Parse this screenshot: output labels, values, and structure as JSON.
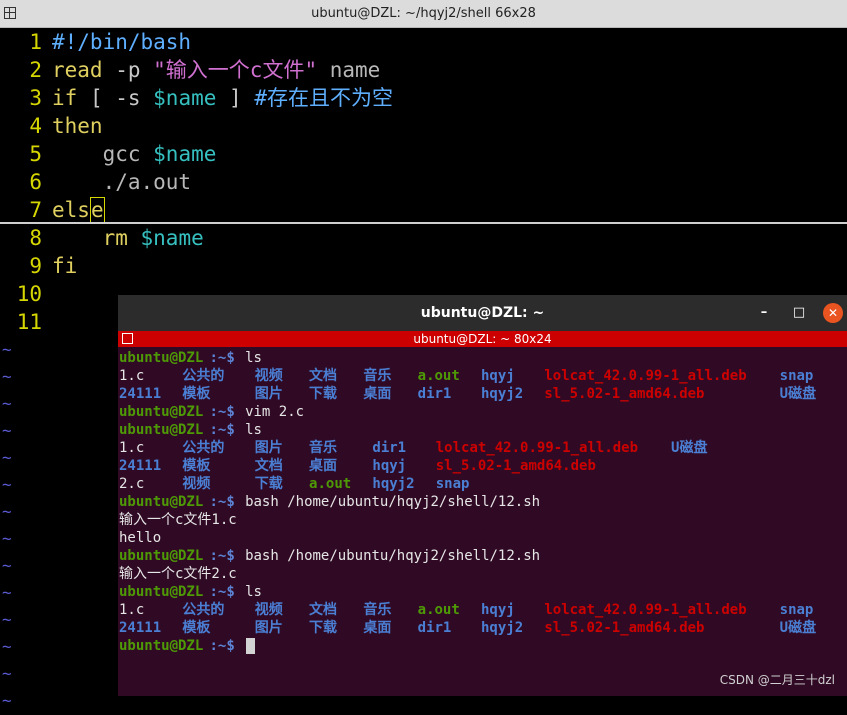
{
  "vim_window": {
    "title": "ubuntu@DZL: ~/hqyj2/shell 66x28",
    "lines": [
      {
        "num": "1",
        "segments": [
          {
            "t": "#!/bin/bash",
            "c": "kw-b"
          }
        ]
      },
      {
        "num": "2",
        "segments": [
          {
            "t": "read",
            "c": "kw-y"
          },
          {
            "t": " -p ",
            "c": "kw-w"
          },
          {
            "t": "\"输入一个c文件\"",
            "c": "kw-p"
          },
          {
            "t": " name",
            "c": "kw-g"
          }
        ]
      },
      {
        "num": "3",
        "segments": [
          {
            "t": "if",
            "c": "kw-y"
          },
          {
            "t": " [ -s ",
            "c": "kw-w"
          },
          {
            "t": "$name",
            "c": "kw-c"
          },
          {
            "t": " ] ",
            "c": "kw-w"
          },
          {
            "t": "#存在且不为空",
            "c": "kw-b"
          }
        ]
      },
      {
        "num": "4",
        "segments": [
          {
            "t": "then",
            "c": "kw-y"
          }
        ]
      },
      {
        "num": "5",
        "segments": [
          {
            "t": "    gcc ",
            "c": "kw-g"
          },
          {
            "t": "$name",
            "c": "kw-c"
          }
        ]
      },
      {
        "num": "6",
        "segments": [
          {
            "t": "    ./a.out",
            "c": "kw-g"
          }
        ]
      },
      {
        "num": "7",
        "segments": [
          {
            "t": "els",
            "c": "kw-y"
          },
          {
            "t": "e",
            "c": "kw-y vcursor"
          }
        ]
      },
      {
        "num": "8",
        "segments": [
          {
            "t": "    rm ",
            "c": "kw-y"
          },
          {
            "t": "$name",
            "c": "kw-c"
          }
        ]
      },
      {
        "num": "9",
        "segments": [
          {
            "t": "fi",
            "c": "kw-y"
          }
        ]
      },
      {
        "num": "10",
        "segments": []
      },
      {
        "num": "11",
        "segments": []
      }
    ],
    "tilde": "~"
  },
  "terminal": {
    "title": "ubuntu@DZL: ~",
    "minimize": "–",
    "maximize": "□",
    "close": "✕",
    "tmux_title": "ubuntu@DZL: ~ 80x24",
    "prompt_user": "ubuntu@DZL",
    "prompt_path": ":~$",
    "lines": [
      {
        "type": "prompt",
        "cmd": " ls"
      },
      {
        "type": "out",
        "items": [
          {
            "t": "1.c",
            "c": "cnorm",
            "col": 0
          },
          {
            "t": "公共的",
            "c": "cdir",
            "col": 7
          },
          {
            "t": "视频",
            "c": "cdir",
            "col": 15
          },
          {
            "t": "文档",
            "c": "cdir",
            "col": 21
          },
          {
            "t": "音乐",
            "c": "cdir",
            "col": 27
          },
          {
            "t": "a.out",
            "c": "cexe",
            "col": 33
          },
          {
            "t": "hqyj",
            "c": "cdir",
            "col": 40
          },
          {
            "t": "lolcat_42.0.99-1_all.deb",
            "c": "cred",
            "col": 47
          },
          {
            "t": "snap",
            "c": "cdir",
            "col": 73
          }
        ]
      },
      {
        "type": "out",
        "items": [
          {
            "t": "24111",
            "c": "cdir",
            "col": 0
          },
          {
            "t": "模板",
            "c": "cdir",
            "col": 7
          },
          {
            "t": "图片",
            "c": "cdir",
            "col": 15
          },
          {
            "t": "下载",
            "c": "cdir",
            "col": 21
          },
          {
            "t": "桌面",
            "c": "cdir",
            "col": 27
          },
          {
            "t": "dir1",
            "c": "cdir",
            "col": 33
          },
          {
            "t": "hqyj2",
            "c": "cdir",
            "col": 40
          },
          {
            "t": "sl_5.02-1_amd64.deb",
            "c": "cred",
            "col": 47
          },
          {
            "t": "U磁盘",
            "c": "cdir",
            "col": 73
          }
        ]
      },
      {
        "type": "prompt",
        "cmd": " vim 2.c"
      },
      {
        "type": "prompt",
        "cmd": " ls"
      },
      {
        "type": "out",
        "items": [
          {
            "t": "1.c",
            "c": "cnorm",
            "col": 0
          },
          {
            "t": "公共的",
            "c": "cdir",
            "col": 7
          },
          {
            "t": "图片",
            "c": "cdir",
            "col": 15
          },
          {
            "t": "音乐",
            "c": "cdir",
            "col": 21
          },
          {
            "t": "dir1",
            "c": "cdir",
            "col": 28
          },
          {
            "t": "lolcat_42.0.99-1_all.deb",
            "c": "cred",
            "col": 35
          },
          {
            "t": "U磁盘",
            "c": "cdir",
            "col": 61
          }
        ]
      },
      {
        "type": "out",
        "items": [
          {
            "t": "24111",
            "c": "cdir",
            "col": 0
          },
          {
            "t": "模板",
            "c": "cdir",
            "col": 7
          },
          {
            "t": "文档",
            "c": "cdir",
            "col": 15
          },
          {
            "t": "桌面",
            "c": "cdir",
            "col": 21
          },
          {
            "t": "hqyj",
            "c": "cdir",
            "col": 28
          },
          {
            "t": "sl_5.02-1_amd64.deb",
            "c": "cred",
            "col": 35
          }
        ]
      },
      {
        "type": "out",
        "items": [
          {
            "t": "2.c",
            "c": "cnorm",
            "col": 0
          },
          {
            "t": "视频",
            "c": "cdir",
            "col": 7
          },
          {
            "t": "下载",
            "c": "cdir",
            "col": 15
          },
          {
            "t": "a.out",
            "c": "cexe",
            "col": 21
          },
          {
            "t": "hqyj2",
            "c": "cdir",
            "col": 28
          },
          {
            "t": "snap",
            "c": "cdir",
            "col": 35
          }
        ]
      },
      {
        "type": "prompt",
        "cmd": " bash /home/ubuntu/hqyj2/shell/12.sh"
      },
      {
        "type": "out",
        "items": [
          {
            "t": "输入一个c文件1.c",
            "c": "cnorm",
            "col": 0
          }
        ]
      },
      {
        "type": "out",
        "items": [
          {
            "t": "hello",
            "c": "cnorm",
            "col": 0
          }
        ]
      },
      {
        "type": "prompt",
        "cmd": " bash /home/ubuntu/hqyj2/shell/12.sh"
      },
      {
        "type": "out",
        "items": [
          {
            "t": "输入一个c文件2.c",
            "c": "cnorm",
            "col": 0
          }
        ]
      },
      {
        "type": "prompt",
        "cmd": " ls"
      },
      {
        "type": "out",
        "items": [
          {
            "t": "1.c",
            "c": "cnorm",
            "col": 0
          },
          {
            "t": "公共的",
            "c": "cdir",
            "col": 7
          },
          {
            "t": "视频",
            "c": "cdir",
            "col": 15
          },
          {
            "t": "文档",
            "c": "cdir",
            "col": 21
          },
          {
            "t": "音乐",
            "c": "cdir",
            "col": 27
          },
          {
            "t": "a.out",
            "c": "cexe",
            "col": 33
          },
          {
            "t": "hqyj",
            "c": "cdir",
            "col": 40
          },
          {
            "t": "lolcat_42.0.99-1_all.deb",
            "c": "cred",
            "col": 47
          },
          {
            "t": "snap",
            "c": "cdir",
            "col": 73
          }
        ]
      },
      {
        "type": "out",
        "items": [
          {
            "t": "24111",
            "c": "cdir",
            "col": 0
          },
          {
            "t": "模板",
            "c": "cdir",
            "col": 7
          },
          {
            "t": "图片",
            "c": "cdir",
            "col": 15
          },
          {
            "t": "下载",
            "c": "cdir",
            "col": 21
          },
          {
            "t": "桌面",
            "c": "cdir",
            "col": 27
          },
          {
            "t": "dir1",
            "c": "cdir",
            "col": 33
          },
          {
            "t": "hqyj2",
            "c": "cdir",
            "col": 40
          },
          {
            "t": "sl_5.02-1_amd64.deb",
            "c": "cred",
            "col": 47
          },
          {
            "t": "U磁盘",
            "c": "cdir",
            "col": 73
          }
        ]
      },
      {
        "type": "prompt",
        "cmd": " ",
        "cursor": true
      }
    ]
  },
  "watermark": "CSDN @二月三十dzl"
}
